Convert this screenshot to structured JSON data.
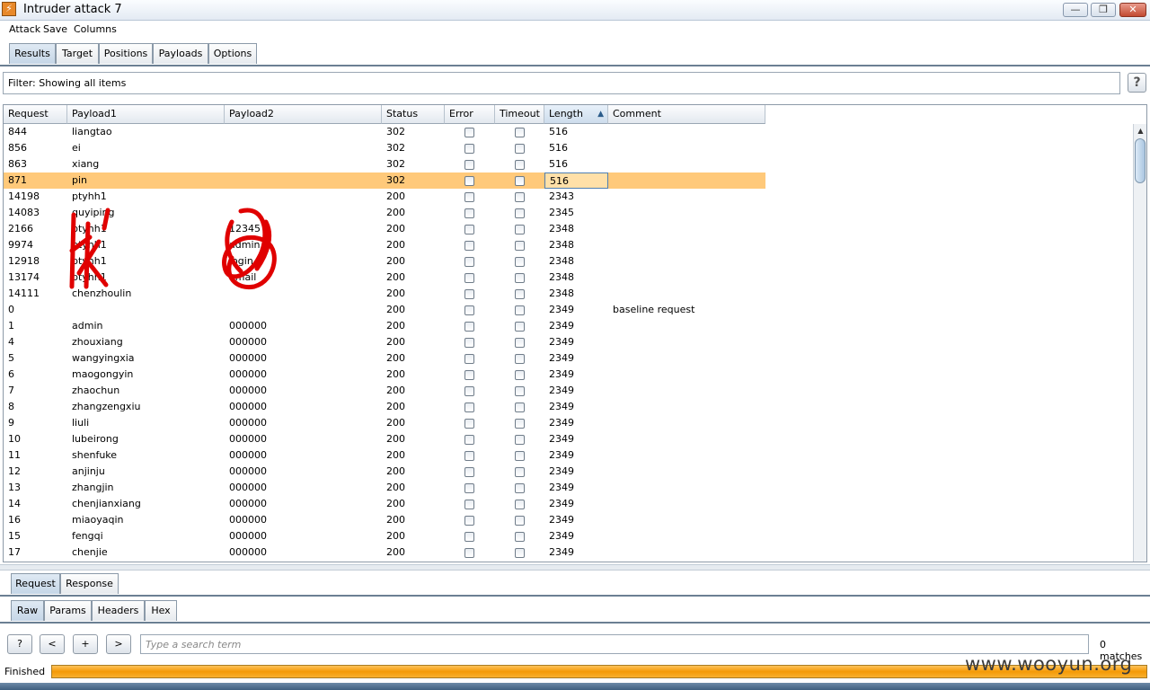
{
  "window": {
    "title": "Intruder attack 7",
    "minimize_glyph": "—",
    "maximize_glyph": "❐",
    "close_glyph": "✕"
  },
  "menu": [
    "Attack",
    "Save",
    "Columns"
  ],
  "tabs": [
    "Results",
    "Target",
    "Positions",
    "Payloads",
    "Options"
  ],
  "active_tab": "Results",
  "filter": {
    "text": "Filter: Showing all items",
    "help": "?"
  },
  "columns": [
    "Request",
    "Payload1",
    "Payload2",
    "Status",
    "Error",
    "Timeout",
    "Length",
    "Comment"
  ],
  "sorted_column": "Length",
  "sort_direction": "ascending",
  "rows": [
    {
      "request": "844",
      "payload1": "liangtao",
      "payload2": "",
      "status": "302",
      "length": "516",
      "comment": ""
    },
    {
      "request": "856",
      "payload1": "ei",
      "payload2": "",
      "status": "302",
      "length": "516",
      "comment": ""
    },
    {
      "request": "863",
      "payload1": "xiang",
      "payload2": "",
      "status": "302",
      "length": "516",
      "comment": ""
    },
    {
      "request": "871",
      "payload1": "pin",
      "payload2": "",
      "status": "302",
      "length": "516",
      "comment": "",
      "selected": true
    },
    {
      "request": "14198",
      "payload1": "ptyhh1",
      "payload2": "",
      "status": "200",
      "length": "2343",
      "comment": ""
    },
    {
      "request": "14083",
      "payload1": "quyiping",
      "payload2": "",
      "status": "200",
      "length": "2345",
      "comment": ""
    },
    {
      "request": "2166",
      "payload1": "ptyhh1",
      "payload2": "12345",
      "status": "200",
      "length": "2348",
      "comment": ""
    },
    {
      "request": "9974",
      "payload1": "ptyhh1",
      "payload2": "admin",
      "status": "200",
      "length": "2348",
      "comment": ""
    },
    {
      "request": "12918",
      "payload1": "ptyhh1",
      "payload2": "login",
      "status": "200",
      "length": "2348",
      "comment": ""
    },
    {
      "request": "13174",
      "payload1": "ptyhh1",
      "payload2": "email",
      "status": "200",
      "length": "2348",
      "comment": ""
    },
    {
      "request": "14111",
      "payload1": "chenzhoulin",
      "payload2": "",
      "status": "200",
      "length": "2348",
      "comment": ""
    },
    {
      "request": "0",
      "payload1": "",
      "payload2": "",
      "status": "200",
      "length": "2349",
      "comment": "baseline request"
    },
    {
      "request": "1",
      "payload1": "admin",
      "payload2": "000000",
      "status": "200",
      "length": "2349",
      "comment": ""
    },
    {
      "request": "4",
      "payload1": "zhouxiang",
      "payload2": "000000",
      "status": "200",
      "length": "2349",
      "comment": ""
    },
    {
      "request": "5",
      "payload1": "wangyingxia",
      "payload2": "000000",
      "status": "200",
      "length": "2349",
      "comment": ""
    },
    {
      "request": "6",
      "payload1": "maogongyin",
      "payload2": "000000",
      "status": "200",
      "length": "2349",
      "comment": ""
    },
    {
      "request": "7",
      "payload1": "zhaochun",
      "payload2": "000000",
      "status": "200",
      "length": "2349",
      "comment": ""
    },
    {
      "request": "8",
      "payload1": "zhangzengxiu",
      "payload2": "000000",
      "status": "200",
      "length": "2349",
      "comment": ""
    },
    {
      "request": "9",
      "payload1": "liuli",
      "payload2": "000000",
      "status": "200",
      "length": "2349",
      "comment": ""
    },
    {
      "request": "10",
      "payload1": "lubeirong",
      "payload2": "000000",
      "status": "200",
      "length": "2349",
      "comment": ""
    },
    {
      "request": "11",
      "payload1": "shenfuke",
      "payload2": "000000",
      "status": "200",
      "length": "2349",
      "comment": ""
    },
    {
      "request": "12",
      "payload1": "anjinju",
      "payload2": "000000",
      "status": "200",
      "length": "2349",
      "comment": ""
    },
    {
      "request": "13",
      "payload1": "zhangjin",
      "payload2": "000000",
      "status": "200",
      "length": "2349",
      "comment": ""
    },
    {
      "request": "14",
      "payload1": "chenjianxiang",
      "payload2": "000000",
      "status": "200",
      "length": "2349",
      "comment": ""
    },
    {
      "request": "16",
      "payload1": "miaoyaqin",
      "payload2": "000000",
      "status": "200",
      "length": "2349",
      "comment": ""
    },
    {
      "request": "15",
      "payload1": "fengqi",
      "payload2": "000000",
      "status": "200",
      "length": "2349",
      "comment": ""
    },
    {
      "request": "17",
      "payload1": "chenjie",
      "payload2": "000000",
      "status": "200",
      "length": "2349",
      "comment": ""
    }
  ],
  "detail_tabs": [
    "Request",
    "Response"
  ],
  "active_detail_tab": "Request",
  "view_tabs": [
    "Raw",
    "Params",
    "Headers",
    "Hex"
  ],
  "active_view_tab": "Raw",
  "search": {
    "help": "?",
    "prev": "<",
    "add": "+",
    "next": ">",
    "placeholder": "Type a search term",
    "value": "",
    "matches": "0 matches"
  },
  "status": {
    "label": "Finished",
    "progress": 1.0
  },
  "watermark": "www.wooyun.org",
  "colors": {
    "selected_row": "#ffc97a",
    "progress": "#f49a06",
    "redaction": "#e00000"
  },
  "icons": {
    "app": "burp-icon",
    "sort": "sort-ascending-icon",
    "help": "help-icon"
  }
}
